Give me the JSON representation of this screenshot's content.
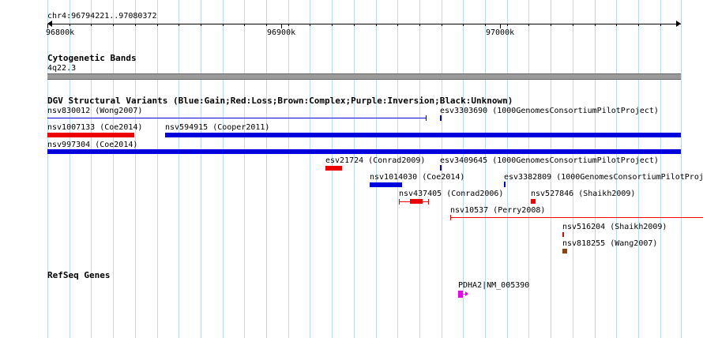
{
  "region": {
    "label": "chr4:96794221..97080372",
    "start": 96794221,
    "end": 97080372
  },
  "ruler": {
    "ticks": [
      "96800k",
      "96900k",
      "97000k"
    ]
  },
  "cyto": {
    "title": "Cytogenetic Bands",
    "band": "4q22.3"
  },
  "dgv": {
    "title": "DGV Structural Variants (Blue:Gain;Red:Loss;Brown:Complex;Purple:Inversion;Black:Unknown)",
    "features": [
      {
        "label": "nsv830012 (Wong2007)",
        "color": "#0000dd",
        "style": "line"
      },
      {
        "label": "esv3303690 (1000GenomesConsortiumPilotProject)",
        "color": "#0000dd",
        "style": "tick"
      },
      {
        "label": "nsv1007133 (Coe2014)",
        "color": "#ee0000",
        "style": "bar"
      },
      {
        "label": "nsv594915 (Cooper2011)",
        "color": "#0000dd",
        "style": "bar"
      },
      {
        "label": "nsv997304 (Coe2014)",
        "color": "#0000dd",
        "style": "bar"
      },
      {
        "label": "esv21724 (Conrad2009)",
        "color": "#ee0000",
        "style": "bar"
      },
      {
        "label": "esv3409645 (1000GenomesConsortiumPilotProject)",
        "color": "#0000dd",
        "style": "tick"
      },
      {
        "label": "nsv1014030 (Coe2014)",
        "color": "#0000dd",
        "style": "bar"
      },
      {
        "label": "esv3382809 (1000GenomesConsortiumPilotProj",
        "color": "#0000dd",
        "style": "tick"
      },
      {
        "label": "nsv437405 (Conrad2006)",
        "color": "#ee0000",
        "style": "segmented"
      },
      {
        "label": "nsv527846 (Shaikh2009)",
        "color": "#ee0000",
        "style": "box"
      },
      {
        "label": "nsv10537 (Perry2008)",
        "color": "#ee0000",
        "style": "line"
      },
      {
        "label": "nsv516204 (Shaikh2009)",
        "color": "#ee0000",
        "style": "tick"
      },
      {
        "label": "nsv818255 (Wang2007)",
        "color": "#8b4513",
        "style": "box"
      }
    ]
  },
  "refseq": {
    "title": "RefSeq Genes",
    "genes": [
      {
        "label": "PDHA2|NM_005390",
        "color": "#ee00ee"
      }
    ]
  }
}
